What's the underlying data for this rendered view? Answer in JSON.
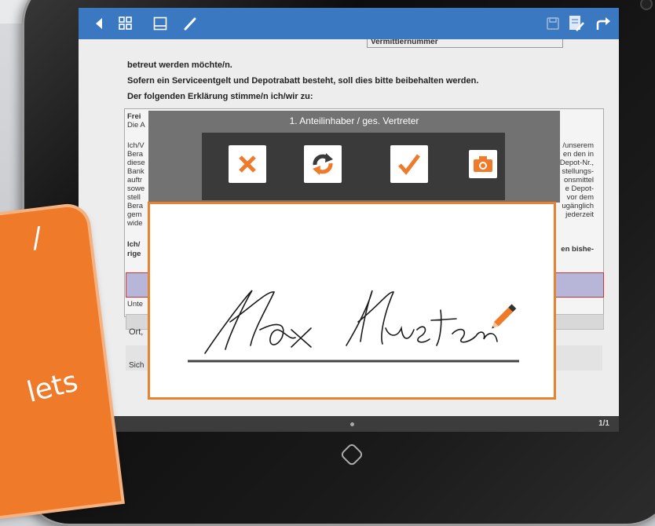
{
  "promo": {
    "text": "lets",
    "mark": "/"
  },
  "toolbar": {
    "icons": [
      "back-icon",
      "grid-icon",
      "page-icon",
      "pen-icon",
      "save-icon",
      "document-edit-icon",
      "share-icon"
    ],
    "accent": "#3b78c2"
  },
  "document": {
    "header_field": "Vermittlernummer",
    "line1": "betreut werden möchte/n.",
    "line2": "Sofern ein Serviceentgelt und Depotrabatt besteht, soll dies bitte beibehalten werden.",
    "line3": "Der folgenden Erklärung stimme/n ich/wir zu:",
    "left_fragments": [
      "Frei",
      "Die A",
      "",
      "Ich/V",
      "Bera",
      "diese",
      "Bank",
      "auftr",
      "sowe",
      "stell",
      "Bera",
      "gem",
      "wide",
      "",
      "Ich/",
      "rige"
    ],
    "right_fragments": [
      "/unserem",
      "en den in",
      "Depot-Nr.,",
      "stellungs-",
      "onsmittel",
      "e Depot-",
      "vor dem",
      "ugänglich",
      "jederzeit",
      "",
      "en bishe-"
    ],
    "under_label": "Unte",
    "ort_label": "Ort,",
    "sich_label": "Sich",
    "page_indicator": "1/1"
  },
  "signature_dialog": {
    "title": "1. Anteilinhaber / ges. Vertreter",
    "buttons": [
      "cancel",
      "reset",
      "confirm",
      "camera"
    ],
    "signature_text": "Max Muster"
  },
  "colors": {
    "orange": "#ee7a2a",
    "blue": "#3b78c2"
  }
}
